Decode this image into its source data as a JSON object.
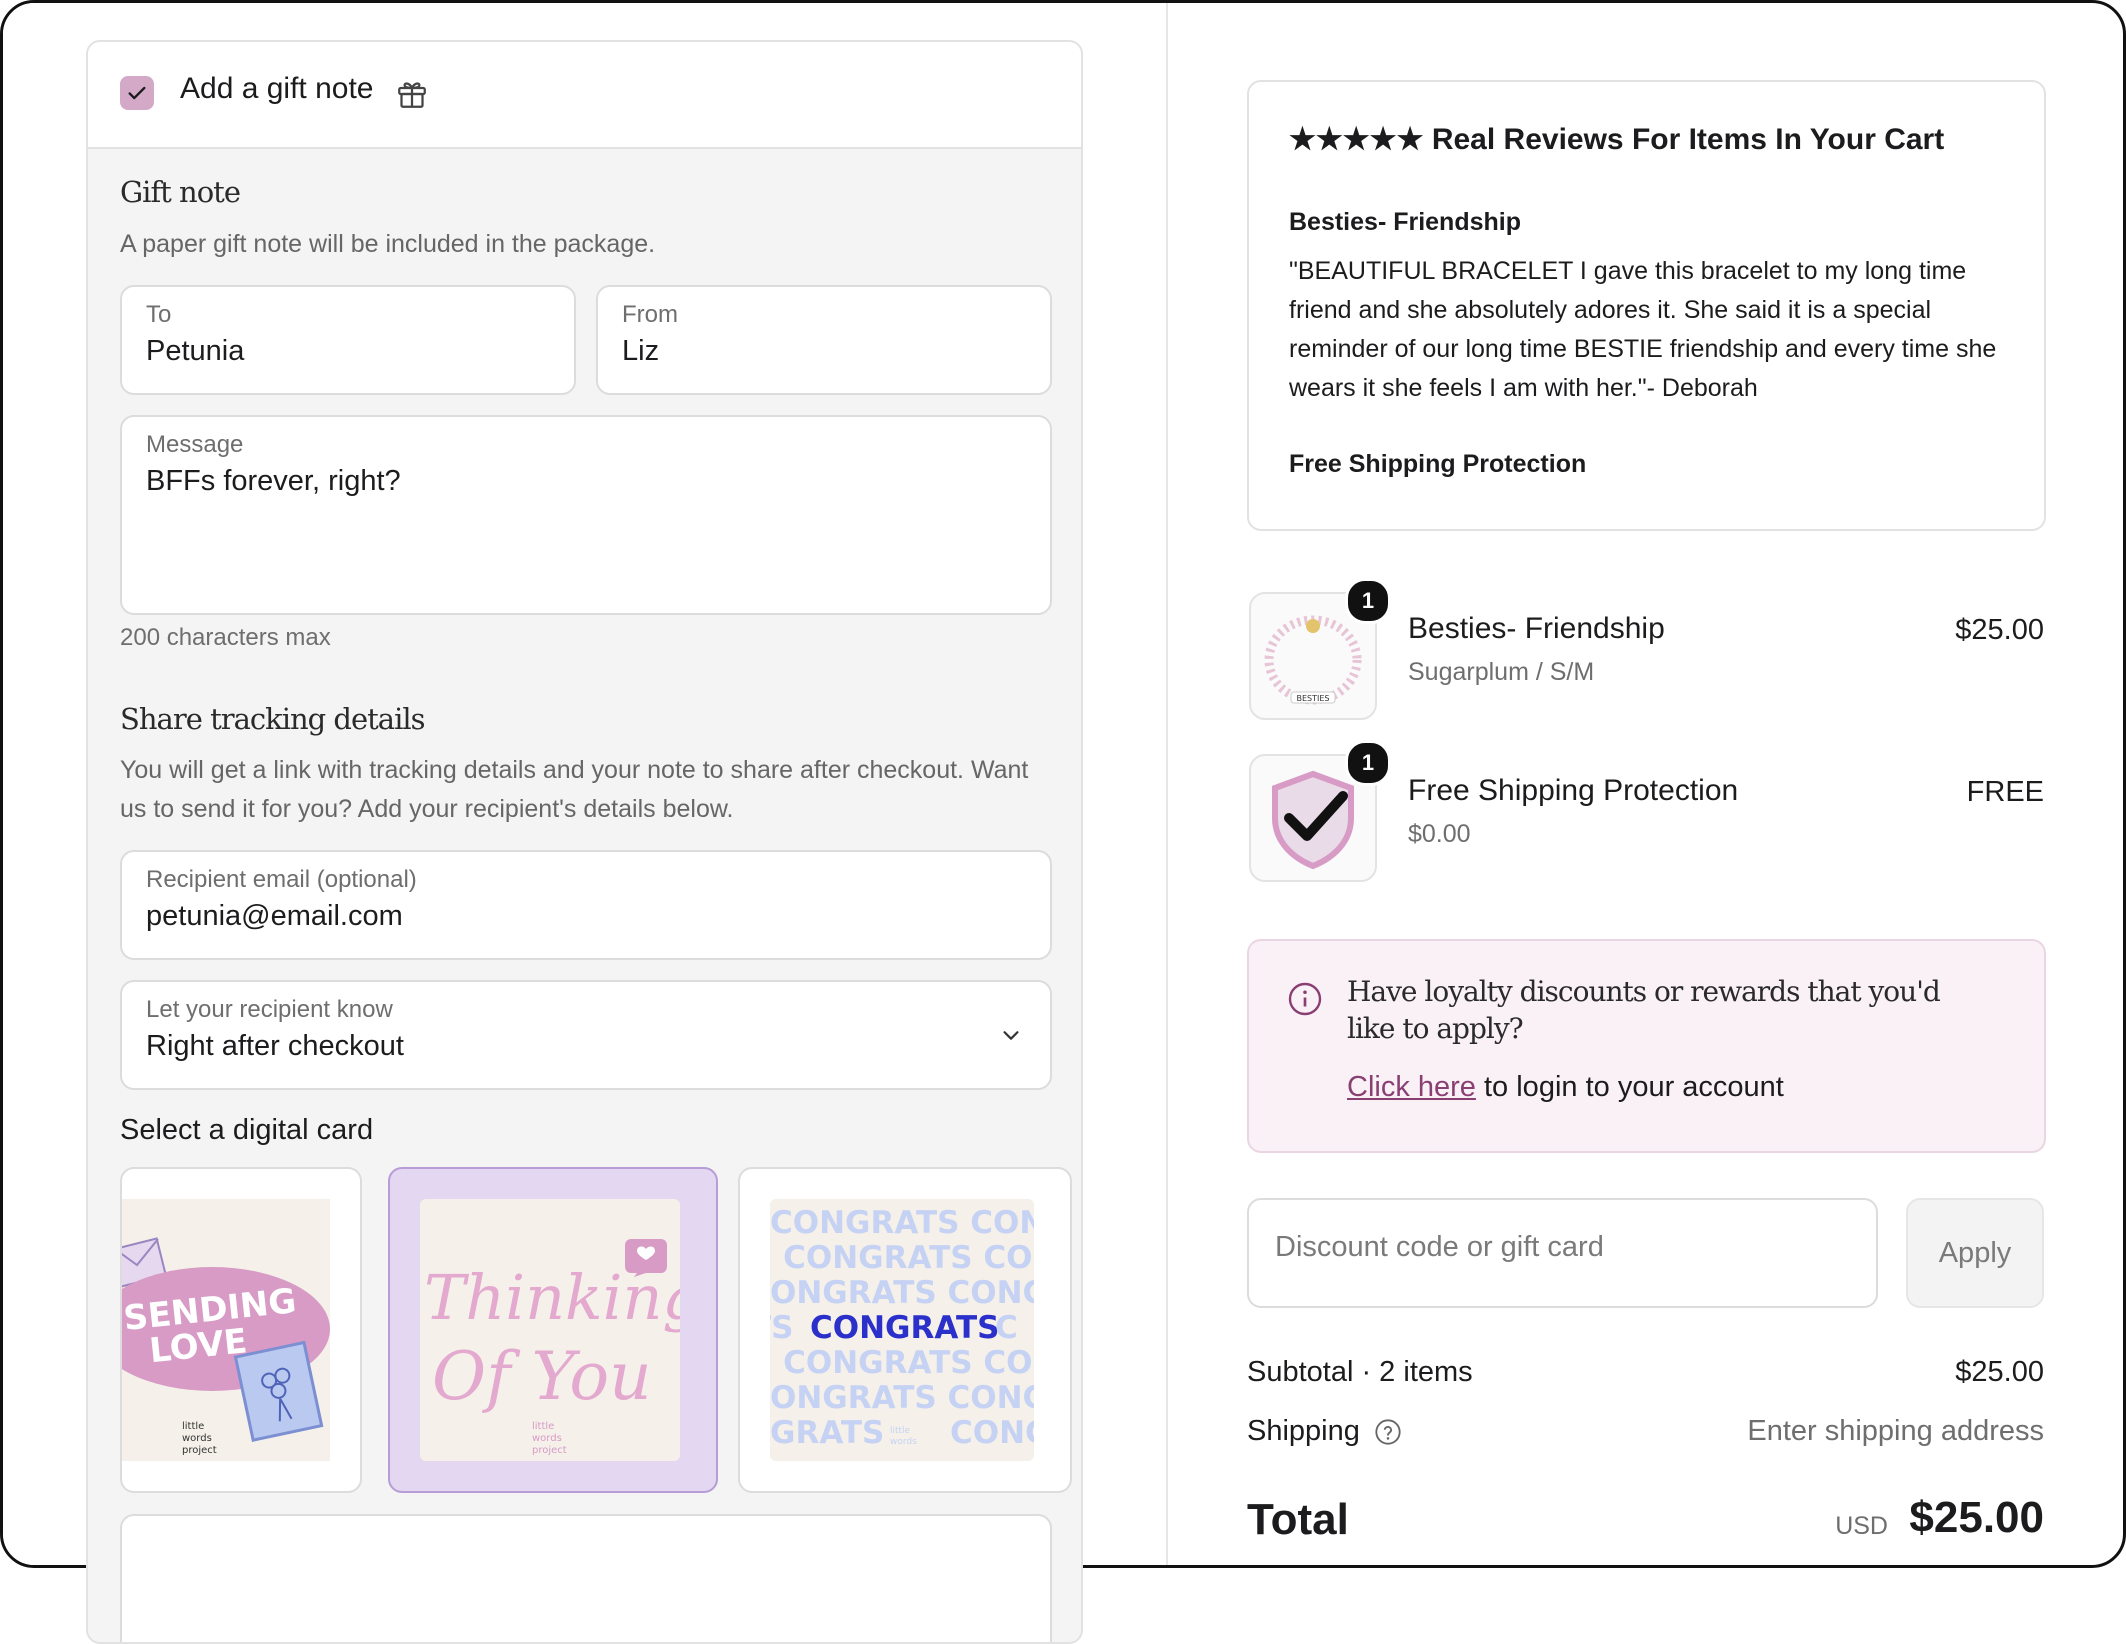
{
  "gift": {
    "checkbox_checked": true,
    "title": "Add a gift note",
    "icon": "gift-icon",
    "note_title": "Gift note",
    "note_desc": "A paper gift note will be included in the package.",
    "to_label": "To",
    "to_value": "Petunia",
    "from_label": "From",
    "from_value": "Liz",
    "message_label": "Message",
    "message_value": "BFFs forever, right?",
    "message_hint": "200 characters max",
    "tracking_title": "Share tracking details",
    "tracking_desc_line1": "You will get a link with tracking details and your note to share after checkout. Want",
    "tracking_desc_line2": "us to send it for you? Add your recipient's details below.",
    "email_label": "Recipient email (optional)",
    "email_value": "petunia@email.com",
    "notify_label": "Let your recipient know",
    "notify_value": "Right after checkout",
    "cards_title": "Select a digital card",
    "cards": [
      {
        "line1": "SENDING",
        "line2": "LOVE",
        "brand": "little words project"
      },
      {
        "line1": "Thinking",
        "line2": "Of You",
        "brand": "little words project",
        "selected": true
      },
      {
        "word": "CONGRATS",
        "brand": "little words project"
      }
    ]
  },
  "reviews": {
    "stars": "★★★★★",
    "title": "Real Reviews For Items In Your Cart",
    "product": "Besties- Friendship",
    "text": "\"BEAUTIFUL BRACELET I gave this bracelet to my long time friend and she absolutely adores it. She said it is a special reminder of our long time BESTIE friendship and every time she wears it she feels I am with her.\"- Deborah",
    "footer": "Free Shipping Protection"
  },
  "cart": {
    "items": [
      {
        "name": "Besties- Friendship",
        "variant": "Sugarplum / S/M",
        "price": "$25.00",
        "qty": "1",
        "bead_text": "BESTIES"
      },
      {
        "name": "Free Shipping Protection",
        "variant": "$0.00",
        "price": "FREE",
        "qty": "1"
      }
    ]
  },
  "loyalty": {
    "text": "Have loyalty discounts or rewards that you'd like to apply?",
    "link": "Click here",
    "link_suffix": "to login to your account"
  },
  "discount": {
    "placeholder": "Discount code or gift card",
    "apply": "Apply"
  },
  "summary": {
    "subtotal_label": "Subtotal · 2 items",
    "subtotal_value": "$25.00",
    "shipping_label": "Shipping",
    "shipping_value": "Enter shipping address",
    "total_label": "Total",
    "currency": "USD",
    "total_value": "$25.00"
  },
  "colors": {
    "accent_pink": "#d4a9c8",
    "link": "#8a3f73",
    "selected_card": "#e3d7f2"
  }
}
